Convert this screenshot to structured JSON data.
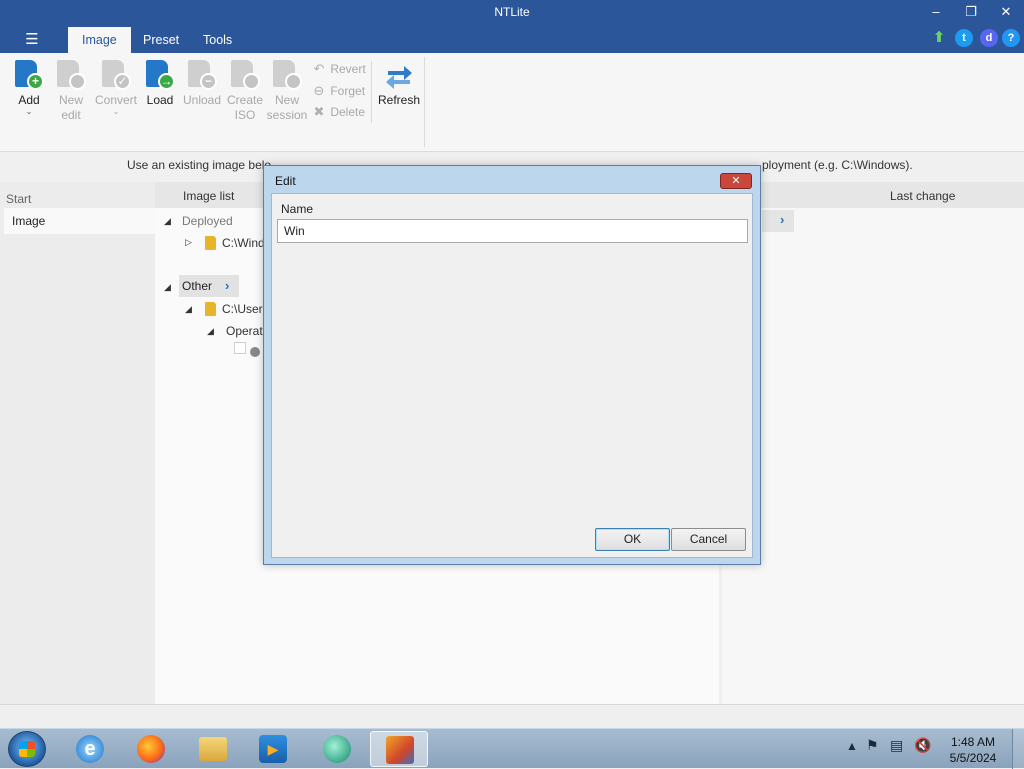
{
  "window": {
    "title": "NTLite"
  },
  "header": {
    "tabs": [
      {
        "label": "Image",
        "active": true
      },
      {
        "label": "Preset",
        "active": false
      },
      {
        "label": "Tools",
        "active": false
      }
    ],
    "colors": {
      "titlebar": "#2b579a"
    }
  },
  "ribbon": {
    "buttons": [
      {
        "label": "Add",
        "enabled": true
      },
      {
        "label": "New edit",
        "enabled": false
      },
      {
        "label": "Convert",
        "enabled": false
      },
      {
        "label": "Load",
        "enabled": true
      },
      {
        "label": "Unload",
        "enabled": false
      },
      {
        "label": "Create ISO",
        "enabled": false
      },
      {
        "label": "New session",
        "enabled": false
      }
    ],
    "small_actions": [
      {
        "label": "Revert",
        "enabled": false
      },
      {
        "label": "Forget",
        "enabled": false
      },
      {
        "label": "Delete",
        "enabled": false
      }
    ],
    "refresh_label": "Refresh"
  },
  "info_text": "Use an existing image belo",
  "info_text_right": "ployment (e.g. C:\\Windows).",
  "sidebar": {
    "heading": "Start",
    "items": [
      {
        "label": "Image",
        "selected": true
      }
    ]
  },
  "image_list": {
    "column_header": "Image list",
    "groups": [
      {
        "name": "Deployed",
        "items": [
          {
            "path": "C:\\Wind"
          }
        ]
      },
      {
        "name": "Other",
        "items": [
          {
            "path": "C:\\Users",
            "children": [
              {
                "label": "Operat"
              }
            ]
          }
        ]
      }
    ]
  },
  "details": {
    "column_last_change": "Last change"
  },
  "dialog": {
    "title": "Edit",
    "field_label": "Name",
    "field_value": "Win",
    "ok_label": "OK",
    "cancel_label": "Cancel"
  },
  "taskbar": {
    "time": "1:48 AM",
    "date": "5/5/2024"
  }
}
